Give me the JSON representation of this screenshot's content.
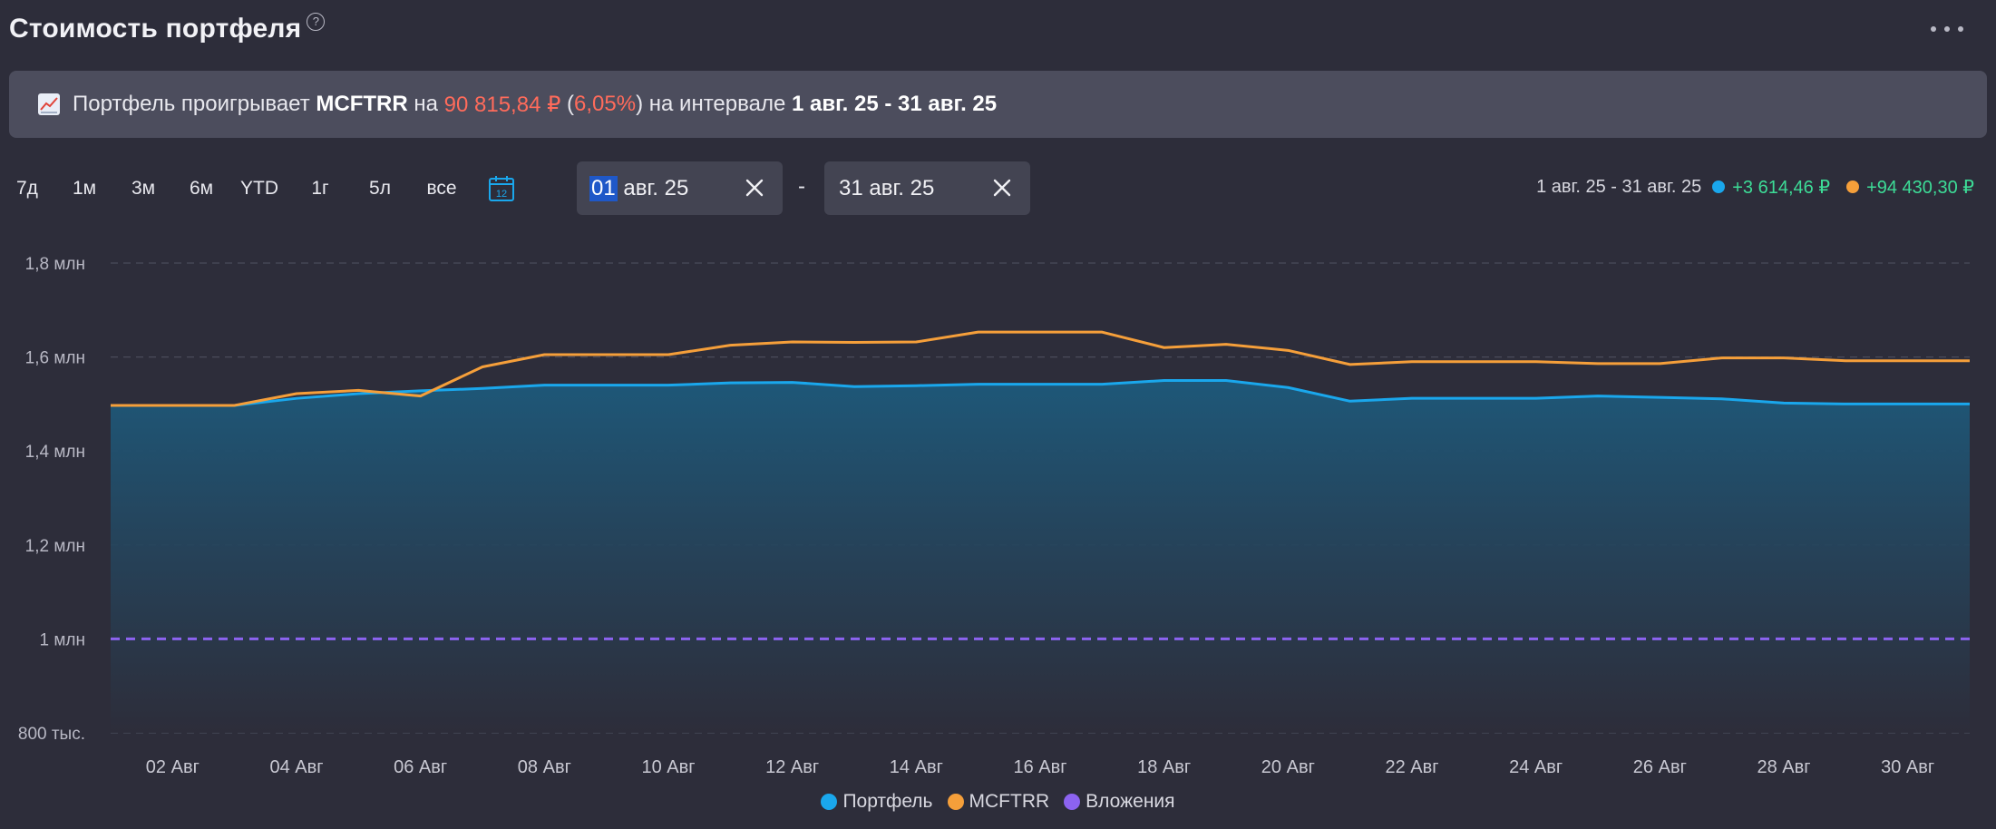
{
  "header": {
    "title": "Стоимость портфеля",
    "help_icon": "question-circle-icon",
    "more_icon": "more-horizontal-icon"
  },
  "banner": {
    "icon": "chart-increasing-emoji",
    "text_prefix": "Портфель проигрывает",
    "benchmark": "MCFTRR",
    "text_on": "на",
    "amount": "90 815,84 ₽",
    "paren_open": " (",
    "percent": "6,05%",
    "paren_close": ")",
    "text_interval": "на интервале",
    "interval": "1 авг. 25 - 31 авг. 25"
  },
  "range_buttons": [
    "7д",
    "1м",
    "3м",
    "6м",
    "YTD",
    "1г",
    "5л",
    "все"
  ],
  "date_from": {
    "selected_part": "01",
    "rest": " авг. 25"
  },
  "date_to": {
    "value": "31 авг. 25"
  },
  "date_separator": "-",
  "summary": {
    "range": "1 авг. 25 - 31 авг. 25",
    "portfolio_gain": "+3 614,46 ₽",
    "benchmark_gain": "+94 430,30 ₽"
  },
  "colors": {
    "portfolio": "#1aa7ec",
    "benchmark": "#f59f3a",
    "investments": "#8c63f0",
    "gain": "#3ddc97",
    "loss": "#ff6b5b"
  },
  "chart_data": {
    "type": "line",
    "y_tick_labels": [
      "800 тыс.",
      "1 млн",
      "1,2 млн",
      "1,4 млн",
      "1,6 млн",
      "1,8 млн"
    ],
    "y_tick_values": [
      800000,
      1000000,
      1200000,
      1400000,
      1600000,
      1800000
    ],
    "ylim": [
      800000,
      1800000
    ],
    "x_tick_labels": [
      "02 Авг",
      "04 Авг",
      "06 Авг",
      "08 Авг",
      "10 Авг",
      "12 Авг",
      "14 Авг",
      "16 Авг",
      "18 Авг",
      "20 Авг",
      "22 Авг",
      "24 Авг",
      "26 Авг",
      "28 Авг",
      "30 Авг"
    ],
    "x_days": [
      1,
      2,
      3,
      4,
      5,
      6,
      7,
      8,
      9,
      10,
      11,
      12,
      13,
      14,
      15,
      16,
      17,
      18,
      19,
      20,
      21,
      22,
      23,
      24,
      25,
      26,
      27,
      28,
      29,
      30,
      31
    ],
    "series": [
      {
        "name": "Портфель",
        "values": [
          1497000,
          1497000,
          1497000,
          1512000,
          1522000,
          1528000,
          1533000,
          1540000,
          1540000,
          1540000,
          1545000,
          1546000,
          1537000,
          1539000,
          1542000,
          1542000,
          1542000,
          1550000,
          1550000,
          1535000,
          1506000,
          1512000,
          1512000,
          1512000,
          1517000,
          1514000,
          1511000,
          1502000,
          1500000,
          1500000,
          1500000
        ]
      },
      {
        "name": "MCFTRR",
        "values": [
          1497000,
          1497000,
          1497000,
          1522000,
          1529000,
          1517000,
          1579000,
          1605000,
          1605000,
          1605000,
          1625000,
          1632000,
          1631000,
          1632000,
          1653000,
          1653000,
          1653000,
          1620000,
          1627000,
          1614000,
          1584000,
          1590000,
          1590000,
          1590000,
          1586000,
          1586000,
          1598000,
          1598000,
          1592000,
          1592000,
          1592000
        ]
      },
      {
        "name": "Вложения",
        "values": [
          1000000,
          1000000,
          1000000,
          1000000,
          1000000,
          1000000,
          1000000,
          1000000,
          1000000,
          1000000,
          1000000,
          1000000,
          1000000,
          1000000,
          1000000,
          1000000,
          1000000,
          1000000,
          1000000,
          1000000,
          1000000,
          1000000,
          1000000,
          1000000,
          1000000,
          1000000,
          1000000,
          1000000,
          1000000,
          1000000,
          1000000
        ]
      }
    ],
    "grid": true,
    "legend": "bottom-center"
  }
}
